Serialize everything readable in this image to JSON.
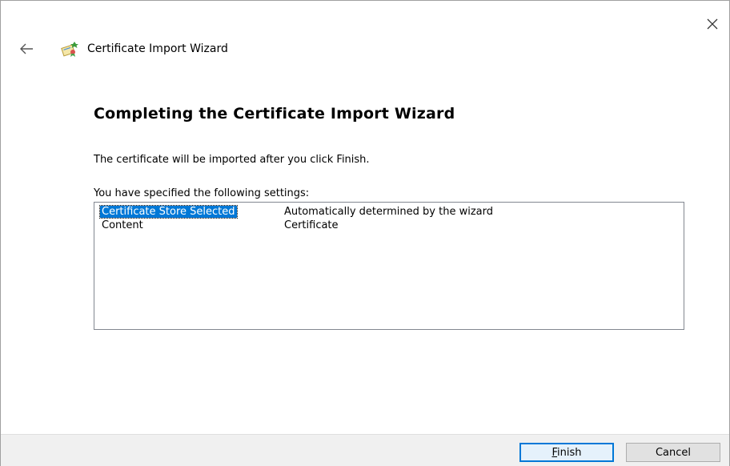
{
  "window": {
    "title": "Certificate Import Wizard",
    "close_icon": "close-icon",
    "back_icon": "back-arrow-icon",
    "wizard_icon": "certificate-wizard-icon"
  },
  "page": {
    "heading": "Completing the Certificate Import Wizard",
    "info_text": "The certificate will be imported after you click Finish.",
    "settings_label": "You have specified the following settings:"
  },
  "settings": {
    "rows": [
      {
        "name": "Certificate Store Selected",
        "value": "Automatically determined by the wizard",
        "selected": true
      },
      {
        "name": "Content",
        "value": "Certificate",
        "selected": false
      }
    ]
  },
  "footer": {
    "finish_label": "Finish",
    "cancel_label": "Cancel"
  },
  "colors": {
    "accent": "#0078d7",
    "footer_bg": "#f0f0f0"
  }
}
